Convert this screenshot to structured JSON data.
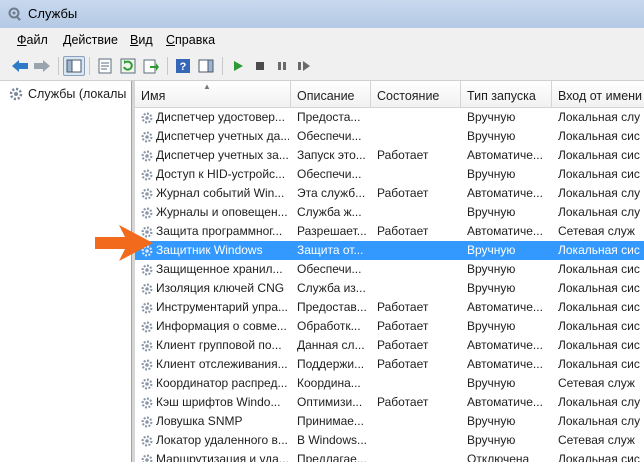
{
  "window": {
    "title": "Службы"
  },
  "menu": [
    "Файл",
    "Действие",
    "Вид",
    "Справка"
  ],
  "tree": {
    "label": "Службы (локалы"
  },
  "columns": [
    "Имя",
    "Описание",
    "Состояние",
    "Тип запуска",
    "Вход от имени"
  ],
  "rows": [
    {
      "name": "Диспетчер удостовер...",
      "desc": "Предоста...",
      "state": "",
      "start": "Вручную",
      "logon": "Локальная слу"
    },
    {
      "name": "Диспетчер учетных да...",
      "desc": "Обеспечи...",
      "state": "",
      "start": "Вручную",
      "logon": "Локальная сис"
    },
    {
      "name": "Диспетчер учетных за...",
      "desc": "Запуск это...",
      "state": "Работает",
      "start": "Автоматиче...",
      "logon": "Локальная сис"
    },
    {
      "name": "Доступ к HID-устройс...",
      "desc": "Обеспечи...",
      "state": "",
      "start": "Вручную",
      "logon": "Локальная сис"
    },
    {
      "name": "Журнал событий Win...",
      "desc": "Эта служб...",
      "state": "Работает",
      "start": "Автоматиче...",
      "logon": "Локальная слу"
    },
    {
      "name": "Журналы и оповещен...",
      "desc": "Служба ж...",
      "state": "",
      "start": "Вручную",
      "logon": "Локальная слу"
    },
    {
      "name": "Защита программног...",
      "desc": "Разрешает...",
      "state": "Работает",
      "start": "Автоматиче...",
      "logon": "Сетевая служ"
    },
    {
      "name": "Защитник Windows",
      "desc": "Защита от...",
      "state": "",
      "start": "Вручную",
      "logon": "Локальная сис"
    },
    {
      "name": "Защищенное хранил...",
      "desc": "Обеспечи...",
      "state": "",
      "start": "Вручную",
      "logon": "Локальная сис"
    },
    {
      "name": "Изоляция ключей CNG",
      "desc": "Служба из...",
      "state": "",
      "start": "Вручную",
      "logon": "Локальная сис"
    },
    {
      "name": "Инструментарий упра...",
      "desc": "Предостав...",
      "state": "Работает",
      "start": "Автоматиче...",
      "logon": "Локальная сис"
    },
    {
      "name": "Информация о совме...",
      "desc": "Обработк...",
      "state": "Работает",
      "start": "Вручную",
      "logon": "Локальная сис"
    },
    {
      "name": "Клиент групповой по...",
      "desc": "Данная сл...",
      "state": "Работает",
      "start": "Автоматиче...",
      "logon": "Локальная сис"
    },
    {
      "name": "Клиент отслеживания...",
      "desc": "Поддержи...",
      "state": "Работает",
      "start": "Автоматиче...",
      "logon": "Локальная сис"
    },
    {
      "name": "Координатор распред...",
      "desc": "Координа...",
      "state": "",
      "start": "Вручную",
      "logon": "Сетевая служ"
    },
    {
      "name": "Кэш шрифтов Windo...",
      "desc": "Оптимизи...",
      "state": "Работает",
      "start": "Автоматиче...",
      "logon": "Локальная слу"
    },
    {
      "name": "Ловушка SNMP",
      "desc": "Принимае...",
      "state": "",
      "start": "Вручную",
      "logon": "Локальная слу"
    },
    {
      "name": "Локатор удаленного в...",
      "desc": "В Windows...",
      "state": "",
      "start": "Вручную",
      "logon": "Сетевая служ"
    },
    {
      "name": "Маршрутизация и уда...",
      "desc": "Предлагае...",
      "state": "",
      "start": "Отключена",
      "logon": "Локальная сис"
    }
  ],
  "selected_row": 7,
  "colors": {
    "selection": "#3399ff",
    "annotation_arrow": "#f26a1b"
  }
}
